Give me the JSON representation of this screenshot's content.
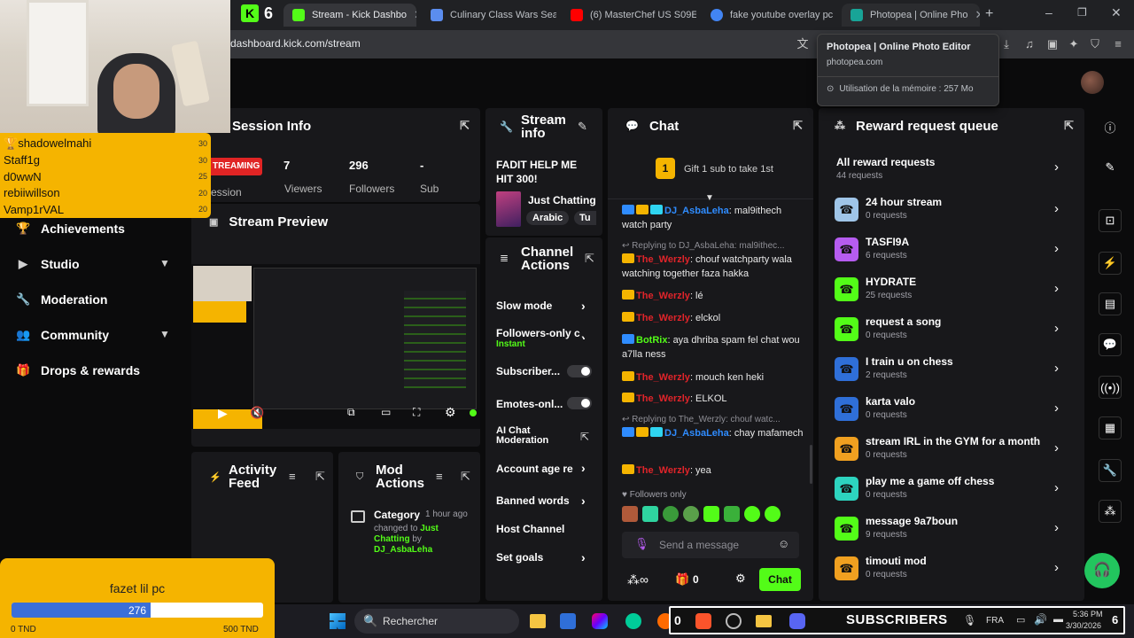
{
  "browser": {
    "tabs": [
      {
        "label": "Stream - Kick Dashbo",
        "color": "#53fc18",
        "active": true
      },
      {
        "label": "Culinary Class Wars Seaso",
        "color": "#5b8def",
        "active": false
      },
      {
        "label": "(6) MasterChef US S09E01",
        "color": "#ff0000",
        "active": false
      },
      {
        "label": "fake youtube overlay pc",
        "color": "#4285f4",
        "active": false
      },
      {
        "label": "Photopea | Online Pho",
        "color": "#18a497",
        "active": false
      }
    ],
    "tab_count": "6",
    "url": "dashboard.kick.com/stream",
    "tooltip": {
      "title": "Photopea | Online Photo Editor",
      "domain": "photopea.com",
      "memory": "Utilisation de la mémoire : 257 Mo"
    }
  },
  "sidebar": {
    "items": [
      {
        "label": "Achievements",
        "icon": "trophy-icon"
      },
      {
        "label": "Studio",
        "icon": "video-icon",
        "expandable": true
      },
      {
        "label": "Moderation",
        "icon": "wrench-icon"
      },
      {
        "label": "Community",
        "icon": "users-icon",
        "expandable": true
      },
      {
        "label": "Drops & rewards",
        "icon": "gift-icon"
      }
    ]
  },
  "leaderboard": {
    "entries": [
      {
        "name": "shadowelmahi",
        "score": "30"
      },
      {
        "name": "Staff1g",
        "score": "30"
      },
      {
        "name": "d0wwN",
        "score": "25"
      },
      {
        "name": "rebiiwillson",
        "score": "20"
      },
      {
        "name": "Vamp1rVAL",
        "score": "20"
      }
    ]
  },
  "goal": {
    "title": "fazet lil pc",
    "current": "276",
    "min": "0 TND",
    "max": "500 TND",
    "progress": 0.552
  },
  "session": {
    "title": "Session Info",
    "status": "TREAMING",
    "session_label": "ession",
    "viewers": "7",
    "viewers_label": "Viewers",
    "followers": "296",
    "followers_label": "Followers",
    "subs": "-",
    "subs_label": "Sub"
  },
  "preview": {
    "title": "Stream Preview"
  },
  "stream_info": {
    "title_1": "Stream",
    "title_2": "info",
    "stream_title": "FADIT HELP ME HIT 300!",
    "category": "Just Chatting",
    "tag1": "Arabic",
    "tag2": "Tu"
  },
  "channel_actions": {
    "title_1": "Channel",
    "title_2": "Actions",
    "items": [
      {
        "label": "Slow mode"
      },
      {
        "label": "Followers-only c",
        "sub": "Instant"
      },
      {
        "label": "Subscriber..."
      },
      {
        "label": "Emotes-onl..."
      },
      {
        "label": "AI Chat Moderation"
      },
      {
        "label": "Account age re"
      },
      {
        "label": "Banned words"
      },
      {
        "label": "Host Channel"
      },
      {
        "label": "Set goals"
      }
    ]
  },
  "activity": {
    "title_1": "Activity",
    "title_2": "Feed"
  },
  "mod_actions": {
    "title_1": "Mod",
    "title_2": "Actions",
    "entry_type": "Category",
    "entry_time": "1 hour ago",
    "entry_text": "changed to",
    "entry_value": "Just Chatting",
    "entry_by": "by",
    "entry_user": "DJ_AsbaLeha"
  },
  "chat": {
    "title": "Chat",
    "gift_count": "1",
    "gift_text": "Gift 1 sub to take 1st",
    "messages": [
      {
        "user": "DJ_AsbaLeha",
        "color": "#2f8cff",
        "text": ": mal9ithech watch party"
      },
      {
        "reply": "Replying to DJ_AsbaLeha: mal9ithec..."
      },
      {
        "user": "The_Werzly",
        "color": "#e0242a",
        "text": ": chouf watchparty wala watching together faza hakka"
      },
      {
        "user": "The_Werzly",
        "color": "#e0242a",
        "text": ": lé"
      },
      {
        "user": "The_Werzly",
        "color": "#e0242a",
        "text": ": elckol"
      },
      {
        "user": "BotRix",
        "color": "#53fc18",
        "text": ": aya dhriba spam fel chat wou a7lla ness"
      },
      {
        "user": "The_Werzly",
        "color": "#e0242a",
        "text": ": mouch ken heki"
      },
      {
        "user": "The_Werzly",
        "color": "#e0242a",
        "text": ": ELKOL"
      },
      {
        "reply": "Replying to The_Werzly: chouf watc..."
      },
      {
        "user": "DJ_AsbaLeha",
        "color": "#2f8cff",
        "text": ": chay mafamech"
      },
      {
        "user": "The_Werzly",
        "color": "#e0242a",
        "text": ": yea"
      }
    ],
    "followers_only": "Followers only",
    "placeholder": "Send a message",
    "count": "0",
    "send_label": "Chat"
  },
  "rewards": {
    "title": "Reward request queue",
    "all_label": "All reward requests",
    "all_count": "44 requests",
    "items": [
      {
        "name": "24 hour stream",
        "count": "0 requests",
        "color": "#9fc5e8"
      },
      {
        "name": "TASFI9A",
        "count": "6 requests",
        "color": "#b65cf0"
      },
      {
        "name": "HYDRATE",
        "count": "25 requests",
        "color": "#53fc18"
      },
      {
        "name": "request a song",
        "count": "0 requests",
        "color": "#53fc18"
      },
      {
        "name": "I train u on chess",
        "count": "2 requests",
        "color": "#2f6fd8"
      },
      {
        "name": "karta valo",
        "count": "0 requests",
        "color": "#2f6fd8"
      },
      {
        "name": "stream IRL in the GYM for a month",
        "count": "0 requests",
        "color": "#f0a020"
      },
      {
        "name": "play me a game off chess",
        "count": "0 requests",
        "color": "#2dd4bf"
      },
      {
        "name": "message 9a7boun",
        "count": "9 requests",
        "color": "#53fc18"
      },
      {
        "name": "timouti mod",
        "count": "0 requests",
        "color": "#f0a020"
      }
    ]
  },
  "overlay": {
    "subscribers": "SUBSCRIBERS",
    "subs_count": "0"
  },
  "taskbar": {
    "search": "Rechercher",
    "lang": "FRA",
    "time": "5:36 PM",
    "date": "3/30/2026"
  },
  "colors": {
    "accent": "#53fc18",
    "panel": "#18181b",
    "bg": "#0b0b0c"
  }
}
